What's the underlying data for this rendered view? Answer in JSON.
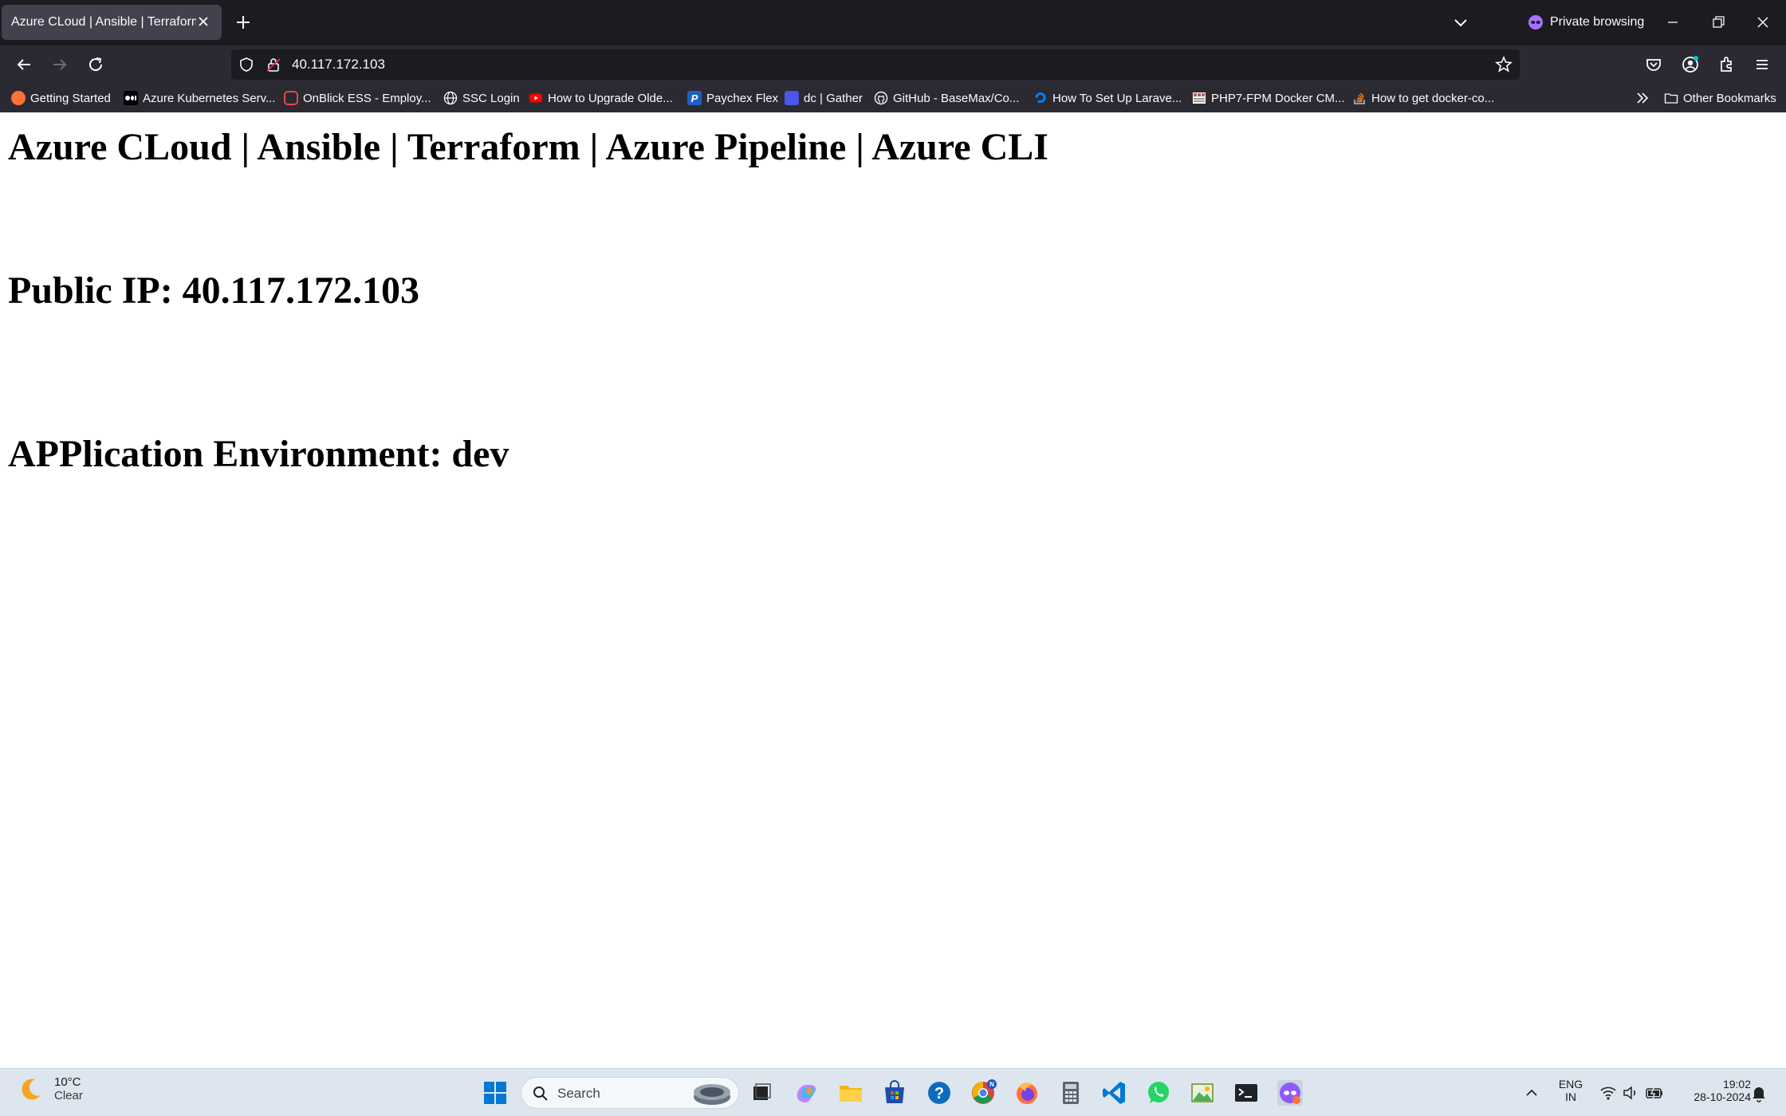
{
  "browser": {
    "tab_title": "Azure CLoud | Ansible | Terraform |",
    "private_label": "Private browsing",
    "url": "40.117.172.103"
  },
  "bookmarks": [
    {
      "label": "Getting Started",
      "icon": "firefox-icon",
      "color": "#ff7139"
    },
    {
      "label": "Azure Kubernetes Serv...",
      "icon": "medium-icon",
      "color": "#ffffff"
    },
    {
      "label": "OnBlick ESS - Employ...",
      "icon": "onblick-icon",
      "color": "#e5484d"
    },
    {
      "label": "SSC Login",
      "icon": "globe-icon",
      "color": "#fbfbfe"
    },
    {
      "label": "How to Upgrade Olde...",
      "icon": "youtube-icon",
      "color": "#ff0000"
    },
    {
      "label": "Paychex Flex",
      "icon": "paychex-icon",
      "color": "#1f5fbf"
    },
    {
      "label": "dc | Gather",
      "icon": "gather-icon",
      "color": "#4b55e8"
    },
    {
      "label": "GitHub - BaseMax/Co...",
      "icon": "github-icon",
      "color": "#fbfbfe"
    },
    {
      "label": "How To Set Up Larave...",
      "icon": "digitalocean-icon",
      "color": "#0080ff"
    },
    {
      "label": "PHP7-FPM Docker CM...",
      "icon": "php-icon",
      "color": "#d9534f"
    },
    {
      "label": "How to get docker-co...",
      "icon": "stackoverflow-icon",
      "color": "#f48024"
    }
  ],
  "other_bookmarks": "Other Bookmarks",
  "page": {
    "title": "Azure CLoud | Ansible | Terraform | Azure Pipeline | Azure CLI",
    "public_ip": "Public IP: 40.117.172.103",
    "environment": "APPlication Environment: dev"
  },
  "taskbar": {
    "temperature": "10°C",
    "condition": "Clear",
    "search_placeholder": "Search",
    "language": "ENG",
    "region": "IN",
    "time": "19:02",
    "date": "28-10-2024"
  },
  "colors": {
    "titlebar": "#1c1b22",
    "toolbar": "#2b2a33",
    "private_accent": "#a970ff",
    "taskbar": "#dde6ee"
  }
}
